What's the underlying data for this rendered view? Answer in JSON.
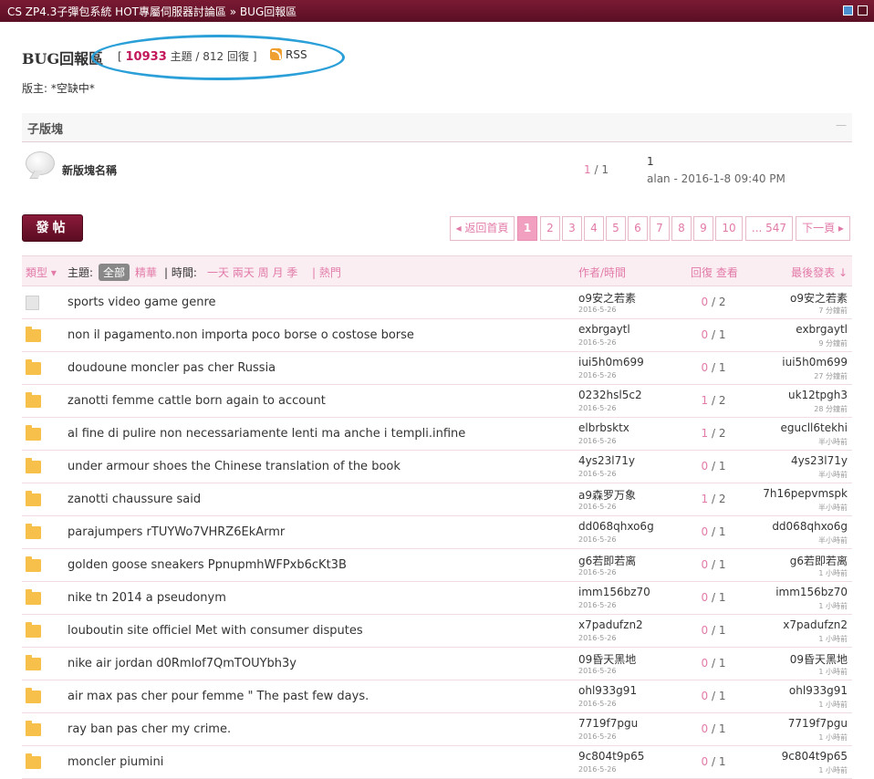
{
  "header": {
    "breadcrumb": "CS ZP4.3子彈包系統 HOT專屬伺服器討論區 » BUG回報區"
  },
  "forum": {
    "title": "BUG回報區",
    "topics_count": "10933",
    "topics_label": "主題",
    "replies_text": "/ 812 回復",
    "bracket_open": "[",
    "bracket_close": "]",
    "rss_label": "RSS",
    "moderator": "版主: *空缺中*"
  },
  "subforum": {
    "heading": "子版塊",
    "collapse": "—",
    "name": "新版塊名稱",
    "topics": "1",
    "posts": "/ 1",
    "last_title": "1",
    "last_info": "alan - 2016-1-8 09:40 PM"
  },
  "post_button": "發帖",
  "pager": {
    "back": "◂ 返回首頁",
    "pages": [
      "1",
      "2",
      "3",
      "4",
      "5",
      "6",
      "7",
      "8",
      "9",
      "10"
    ],
    "current": "1",
    "last": "... 547",
    "next": "下一頁 ▸"
  },
  "list_header": {
    "type": "類型 ▾",
    "subject_label": "主題:",
    "all": "全部",
    "digest": "精華",
    "time_label": "| 時間:",
    "time_filters": "一天 兩天 周 月 季",
    "hot": "| 熱門",
    "author_time": "作者/時間",
    "reply_view": "回復 查看",
    "last_post": "最後發表 ↓"
  },
  "threads": [
    {
      "icon": "doc",
      "subject": "sports video game genre",
      "author": "o9安之若素",
      "date": "2016-5-26",
      "replies": "0",
      "views": "/ 2",
      "last_poster": "o9安之若素",
      "last_time": "7 分鐘前"
    },
    {
      "icon": "folder",
      "subject": "non il pagamento.non importa poco borse o costose borse",
      "author": "exbrgaytl",
      "date": "2016-5-26",
      "replies": "0",
      "views": "/ 1",
      "last_poster": "exbrgaytl",
      "last_time": "9 分鐘前"
    },
    {
      "icon": "folder",
      "subject": "doudoune moncler pas cher Russia",
      "author": "iui5h0m699",
      "date": "2016-5-26",
      "replies": "0",
      "views": "/ 1",
      "last_poster": "iui5h0m699",
      "last_time": "27 分鐘前"
    },
    {
      "icon": "folder",
      "subject": "zanotti femme cattle born again to account",
      "author": "0232hsl5c2",
      "date": "2016-5-26",
      "replies": "1",
      "views": "/ 2",
      "last_poster": "uk12tpgh3",
      "last_time": "28 分鐘前"
    },
    {
      "icon": "folder",
      "subject": "al fine di pulire non necessariamente lenti ma anche i templi.infine",
      "author": "elbrbsktx",
      "date": "2016-5-26",
      "replies": "1",
      "views": "/ 2",
      "last_poster": "egucll6tekhi",
      "last_time": "半小時前"
    },
    {
      "icon": "folder",
      "subject": "under armour shoes the Chinese translation of the book",
      "author": "4ys23l71y",
      "date": "2016-5-26",
      "replies": "0",
      "views": "/ 1",
      "last_poster": "4ys23l71y",
      "last_time": "半小時前"
    },
    {
      "icon": "folder",
      "subject": "zanotti chaussure said",
      "author": "a9森罗万象",
      "date": "2016-5-26",
      "replies": "1",
      "views": "/ 2",
      "last_poster": "7h16pepvmspk",
      "last_time": "半小時前"
    },
    {
      "icon": "folder",
      "subject": "parajumpers rTUYWo7VHRZ6EkArmr",
      "author": "dd068qhxo6g",
      "date": "2016-5-26",
      "replies": "0",
      "views": "/ 1",
      "last_poster": "dd068qhxo6g",
      "last_time": "半小時前"
    },
    {
      "icon": "folder",
      "subject": "golden goose sneakers PpnupmhWFPxb6cKt3B",
      "author": "g6若即若离",
      "date": "2016-5-26",
      "replies": "0",
      "views": "/ 1",
      "last_poster": "g6若即若离",
      "last_time": "1 小時前"
    },
    {
      "icon": "folder",
      "subject": "nike tn 2014 a pseudonym",
      "author": "imm156bz70",
      "date": "2016-5-26",
      "replies": "0",
      "views": "/ 1",
      "last_poster": "imm156bz70",
      "last_time": "1 小時前"
    },
    {
      "icon": "folder",
      "subject": "louboutin site officiel Met with consumer disputes",
      "author": "x7padufzn2",
      "date": "2016-5-26",
      "replies": "0",
      "views": "/ 1",
      "last_poster": "x7padufzn2",
      "last_time": "1 小時前"
    },
    {
      "icon": "folder",
      "subject": "nike air jordan d0Rmlof7QmTOUYbh3y",
      "author": "09昏天黑地",
      "date": "2016-5-26",
      "replies": "0",
      "views": "/ 1",
      "last_poster": "09昏天黑地",
      "last_time": "1 小時前"
    },
    {
      "icon": "folder",
      "subject": "air max pas cher pour femme \" The past few days.",
      "author": "ohl933g91",
      "date": "2016-5-26",
      "replies": "0",
      "views": "/ 1",
      "last_poster": "ohl933g91",
      "last_time": "1 小時前"
    },
    {
      "icon": "folder",
      "subject": "ray ban pas cher my crime.",
      "author": "7719f7pgu",
      "date": "2016-5-26",
      "replies": "0",
      "views": "/ 1",
      "last_poster": "7719f7pgu",
      "last_time": "1 小時前"
    },
    {
      "icon": "folder",
      "subject": "moncler piumini",
      "author": "9c804t9p65",
      "date": "2016-5-26",
      "replies": "0",
      "views": "/ 1",
      "last_poster": "9c804t9p65",
      "last_time": "1 小時前"
    }
  ]
}
